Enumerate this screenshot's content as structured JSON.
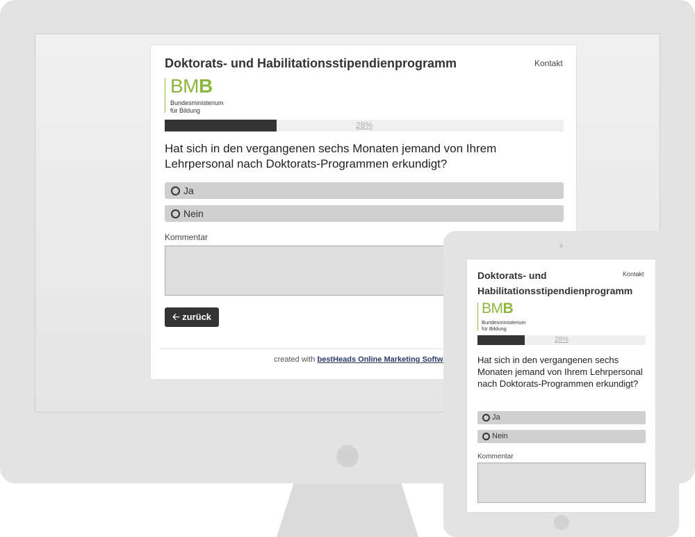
{
  "survey": {
    "title": "Doktorats- und Habilitationsstipendienprogramm",
    "title_line1": "Doktorats- und",
    "title_line2": "Habilitationsstipendienprogramm",
    "contact_label": "Kontakt",
    "logo": {
      "letters_light": "BM",
      "letters_bold": "B",
      "sub_line1": "Bundesministerium",
      "sub_line2": "für Bildung",
      "color": "#8cb63c"
    },
    "progress": {
      "percent": 28,
      "label": "28%"
    },
    "question": "Hat sich in den vergangenen sechs Monaten jemand von Ihrem Lehrpersonal nach Doktorats-Programmen erkundigt?",
    "options": [
      {
        "label": "Ja",
        "selected": false
      },
      {
        "label": "Nein",
        "selected": false
      }
    ],
    "comment_label": "Kommentar",
    "comment_value": "",
    "back_button": {
      "icon": "arrow-left-icon",
      "label": "zurück"
    },
    "footer_prefix": "created with",
    "footer_link": "bestHeads Online Marketing Software"
  },
  "colors": {
    "accent": "#8cb63c",
    "dark": "#333333",
    "option_bg": "#cfcfcf",
    "frame": "#e4e3e4"
  }
}
